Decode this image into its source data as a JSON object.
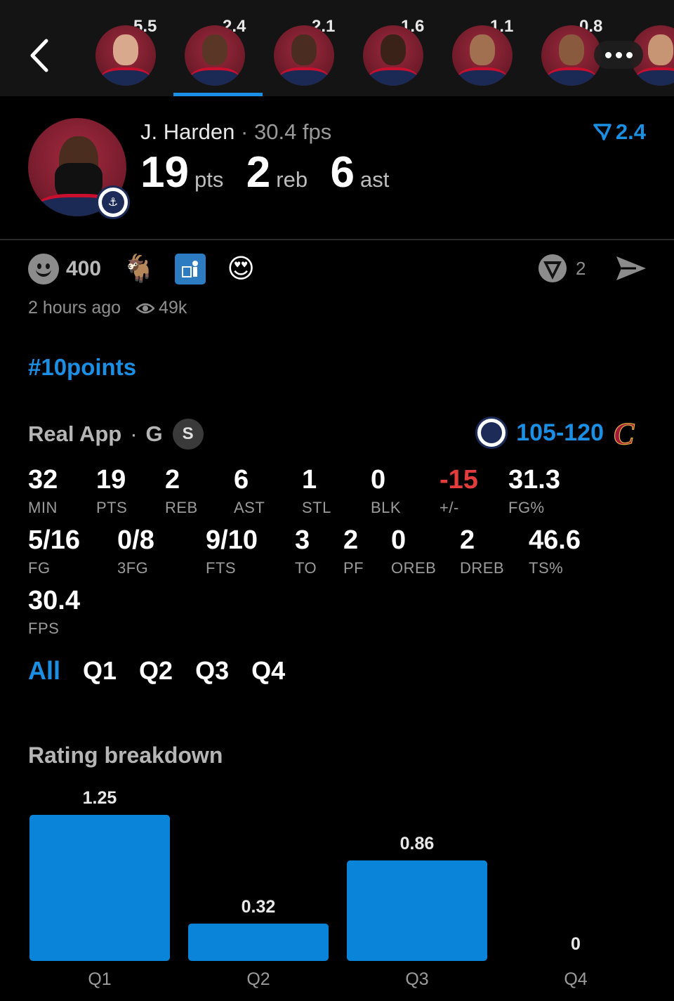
{
  "top_players": [
    {
      "rating": "5.5",
      "skin": "#d8a98d"
    },
    {
      "rating": "2.4",
      "skin": "#5a3626",
      "active": true
    },
    {
      "rating": "2.1",
      "skin": "#4a2c20"
    },
    {
      "rating": "1.6",
      "skin": "#3b2218"
    },
    {
      "rating": "1.1",
      "skin": "#a07050"
    },
    {
      "rating": "0.8",
      "skin": "#8a5a3e"
    },
    {
      "rating": "",
      "skin": "#c79474"
    }
  ],
  "player": {
    "name": "J. Harden",
    "separator": "·",
    "fps": "30.4 fps",
    "rating": "2.4",
    "pts": "19",
    "pts_label": "pts",
    "reb": "2",
    "reb_label": "reb",
    "ast": "6",
    "ast_label": "ast"
  },
  "reactions": {
    "count": "400",
    "goat": "🐐",
    "heart_eyes": "😍",
    "comments": "2"
  },
  "meta": {
    "time": "2 hours ago",
    "views": "49k"
  },
  "hashtag": "#10points",
  "game": {
    "source": "Real App",
    "dot": "·",
    "position": "G",
    "badge": "S",
    "score": "105-120",
    "away_logo_glyph": "C"
  },
  "stats": [
    {
      "value": "32",
      "label": "MIN"
    },
    {
      "value": "19",
      "label": "PTS"
    },
    {
      "value": "2",
      "label": "REB"
    },
    {
      "value": "6",
      "label": "AST"
    },
    {
      "value": "1",
      "label": "STL"
    },
    {
      "value": "0",
      "label": "BLK"
    },
    {
      "value": "-15",
      "label": "+/-"
    },
    {
      "value": "31.3",
      "label": "FG%"
    },
    {
      "value": "5/16",
      "label": "FG"
    },
    {
      "value": "0/8",
      "label": "3FG"
    },
    {
      "value": "9/10",
      "label": "FTS"
    },
    {
      "value": "3",
      "label": "TO"
    },
    {
      "value": "2",
      "label": "PF"
    },
    {
      "value": "0",
      "label": "OREB"
    },
    {
      "value": "2",
      "label": "DREB"
    },
    {
      "value": "46.6",
      "label": "TS%"
    },
    {
      "value": "30.4",
      "label": "FPS"
    }
  ],
  "quarter_tabs": [
    "All",
    "Q1",
    "Q2",
    "Q3",
    "Q4"
  ],
  "breakdown_title": "Rating breakdown",
  "colors": {
    "accent": "#1a8fe3",
    "negative": "#e43b3b",
    "bar": "#0a84d8"
  },
  "chart_data": {
    "type": "bar",
    "categories": [
      "Q1",
      "Q2",
      "Q3",
      "Q4"
    ],
    "values": [
      1.25,
      0.32,
      0.86,
      0
    ],
    "labels": [
      "1.25",
      "0.32",
      "0.86",
      "0"
    ],
    "ylim": [
      0,
      1.25
    ]
  }
}
